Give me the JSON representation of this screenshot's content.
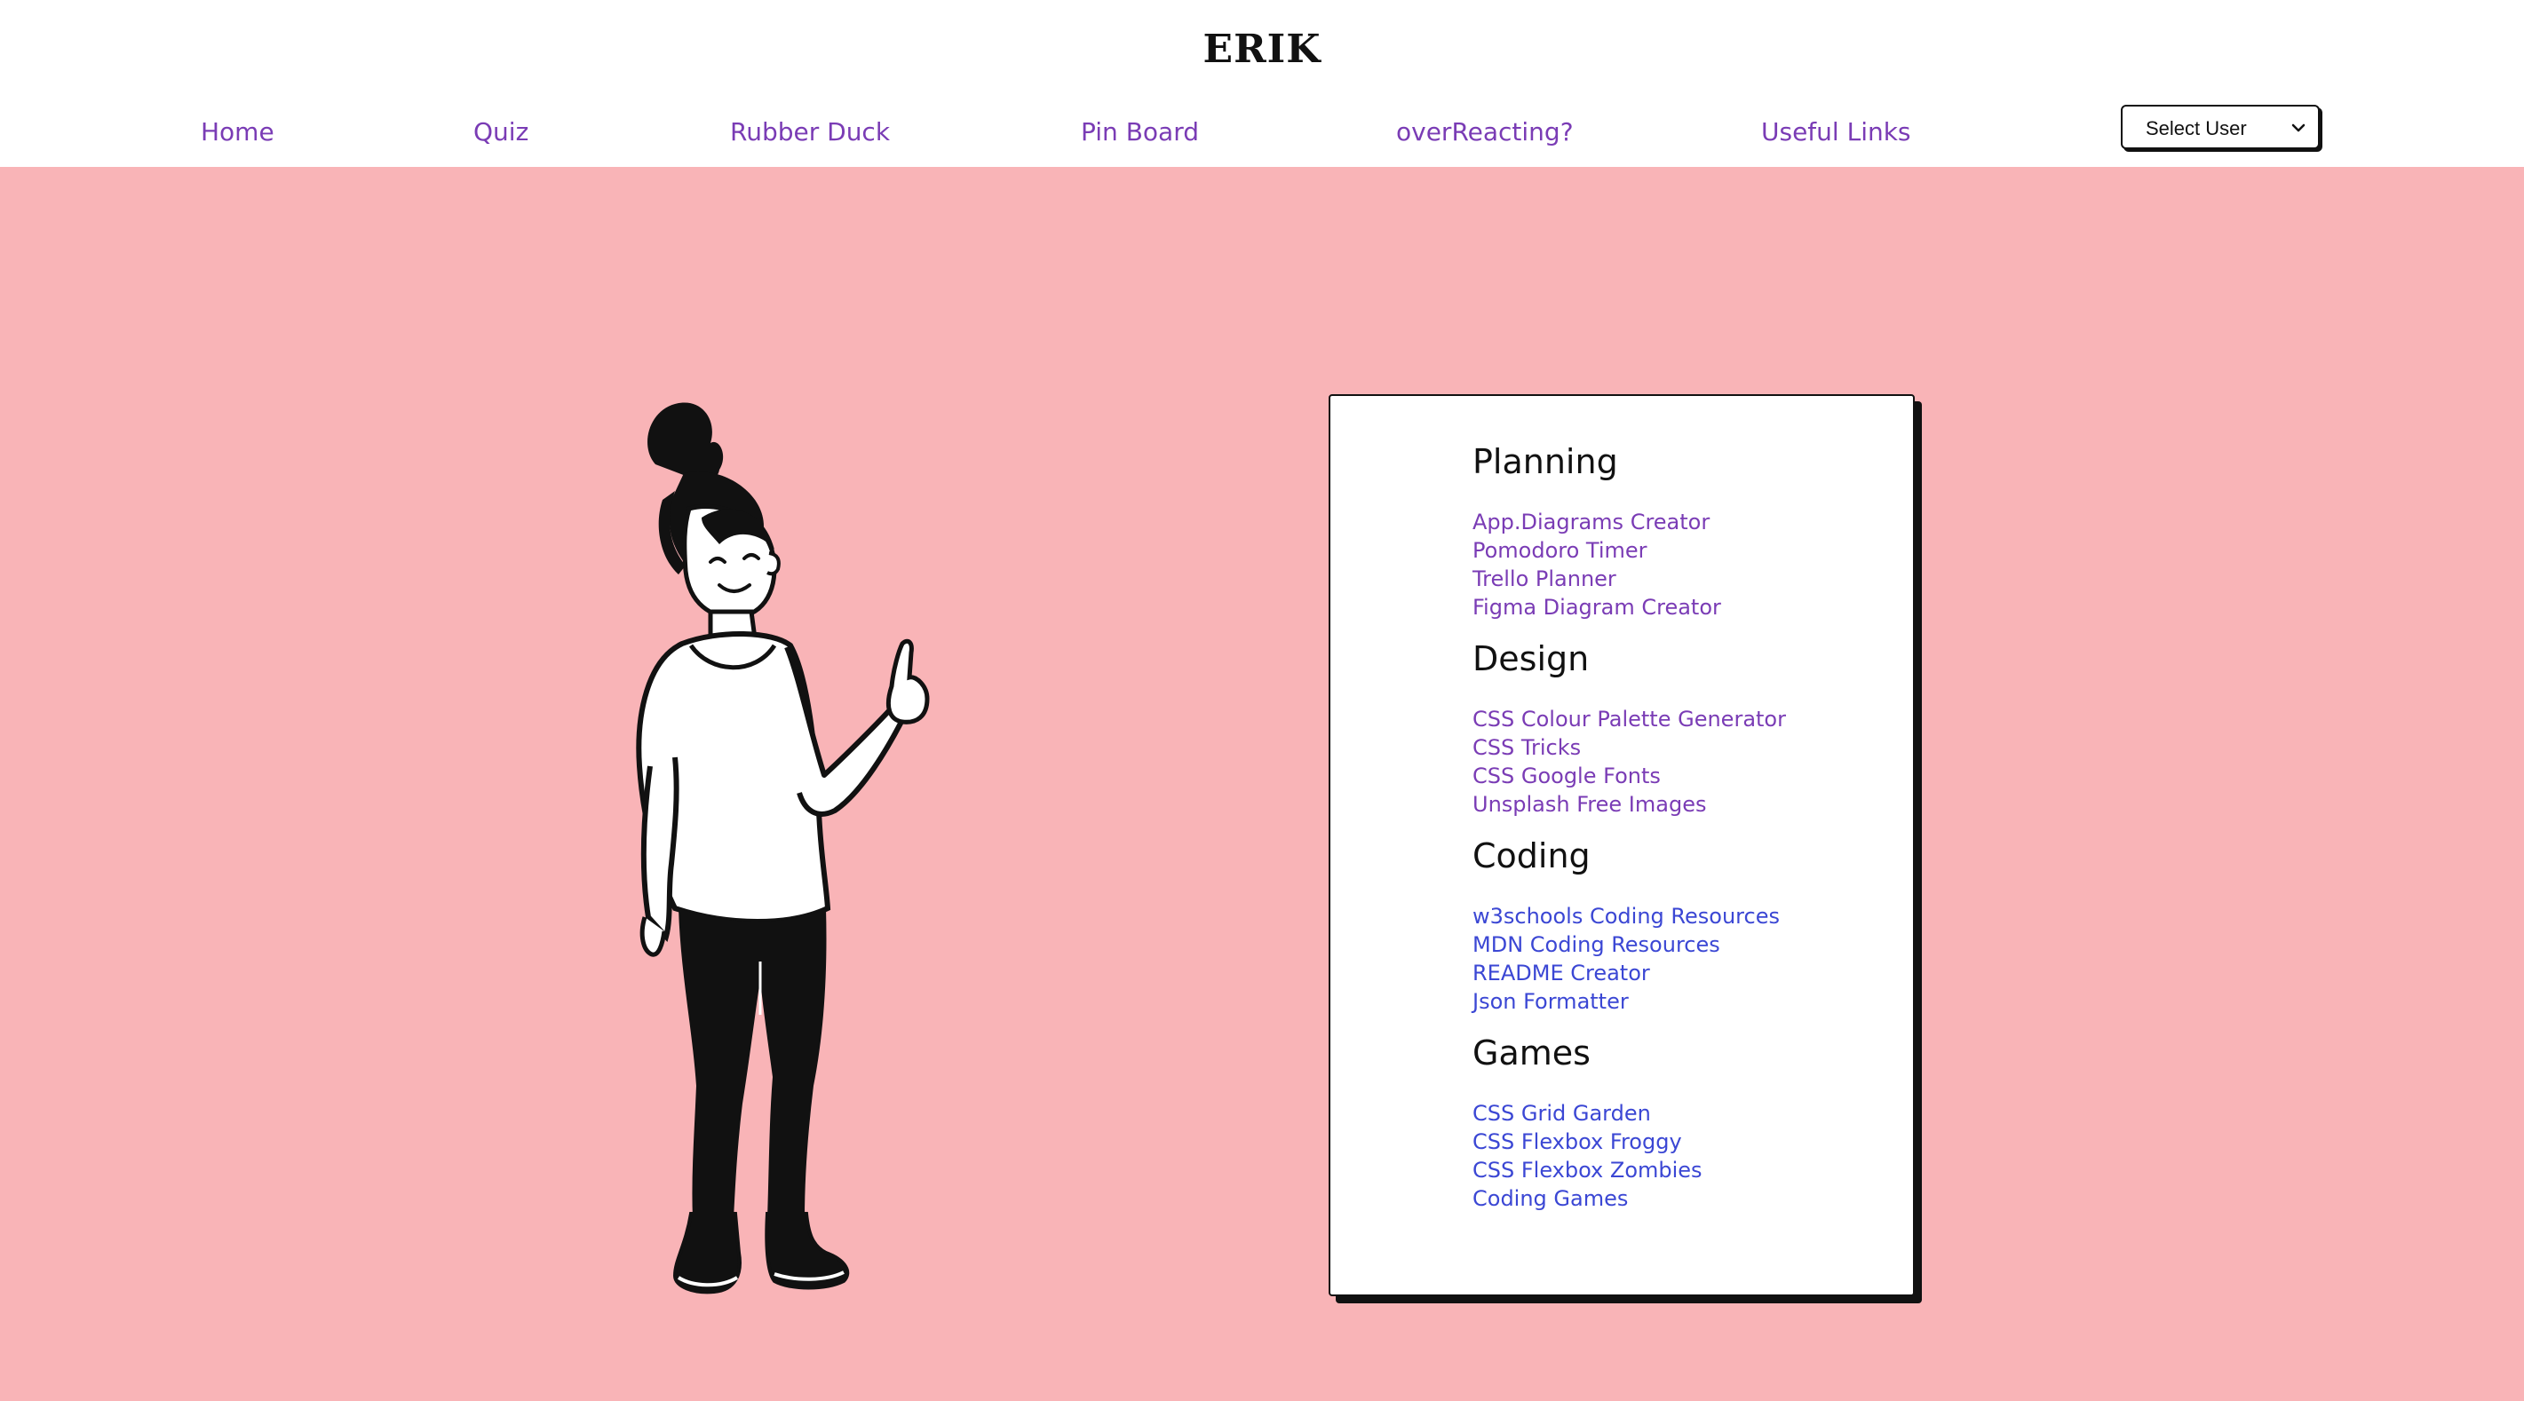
{
  "brand": "ERIK",
  "nav": [
    {
      "label": "Home"
    },
    {
      "label": "Quiz"
    },
    {
      "label": "Rubber Duck"
    },
    {
      "label": "Pin Board"
    },
    {
      "label": "overReacting?"
    },
    {
      "label": "Useful Links"
    }
  ],
  "user_select": {
    "selected": "Select User",
    "icon": "chevron-down-icon"
  },
  "illustration": {
    "icon": "person-pointing-illustration"
  },
  "colors": {
    "page_background": "#f9b4b7",
    "nav_link": "#7a3cb5",
    "visited_link": "#7a3cb5",
    "unvisited_link": "#3b47d4",
    "card_background": "#ffffff",
    "card_shadow": "#111111"
  },
  "links": {
    "sections": [
      {
        "title": "Planning",
        "items": [
          "App.Diagrams Creator",
          "Pomodoro Timer",
          "Trello Planner",
          "Figma Diagram Creator"
        ]
      },
      {
        "title": "Design",
        "items": [
          "CSS Colour Palette Generator",
          "CSS Tricks",
          "CSS Google Fonts",
          "Unsplash Free Images"
        ]
      },
      {
        "title": "Coding",
        "items": [
          "w3schools Coding Resources",
          "MDN Coding Resources",
          "README Creator",
          "Json Formatter"
        ]
      },
      {
        "title": "Games",
        "items": [
          "CSS Grid Garden",
          "CSS Flexbox Froggy",
          "CSS Flexbox Zombies",
          "Coding Games"
        ]
      }
    ]
  }
}
